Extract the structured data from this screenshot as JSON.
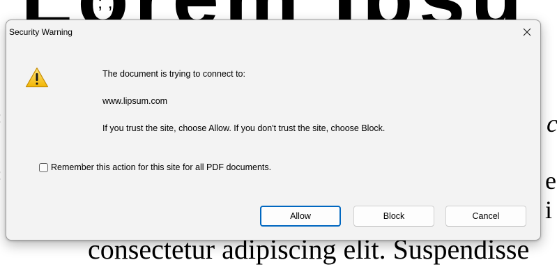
{
  "background": {
    "top_text": "Lorem Ipsu",
    "top_small_text": "; ,",
    "right_text_1": "c",
    "right_text_2": "e i",
    "left_text_1": ":",
    "left_text_2": ":",
    "bottom_text": "consectetur adipiscing elit. Suspendisse"
  },
  "dialog": {
    "title": "Security Warning",
    "close_icon": "close-icon",
    "warning_icon": "warning-icon",
    "message_line1": "The document is trying to connect to:",
    "site": "www.lipsum.com",
    "message_line3": "If you trust the site, choose Allow. If you don't trust the site, choose Block.",
    "remember_label": "Remember this action for this site for all PDF documents.",
    "remember_checked": false,
    "buttons": {
      "allow": "Allow",
      "block": "Block",
      "cancel": "Cancel"
    },
    "accent_color": "#0067c0"
  }
}
